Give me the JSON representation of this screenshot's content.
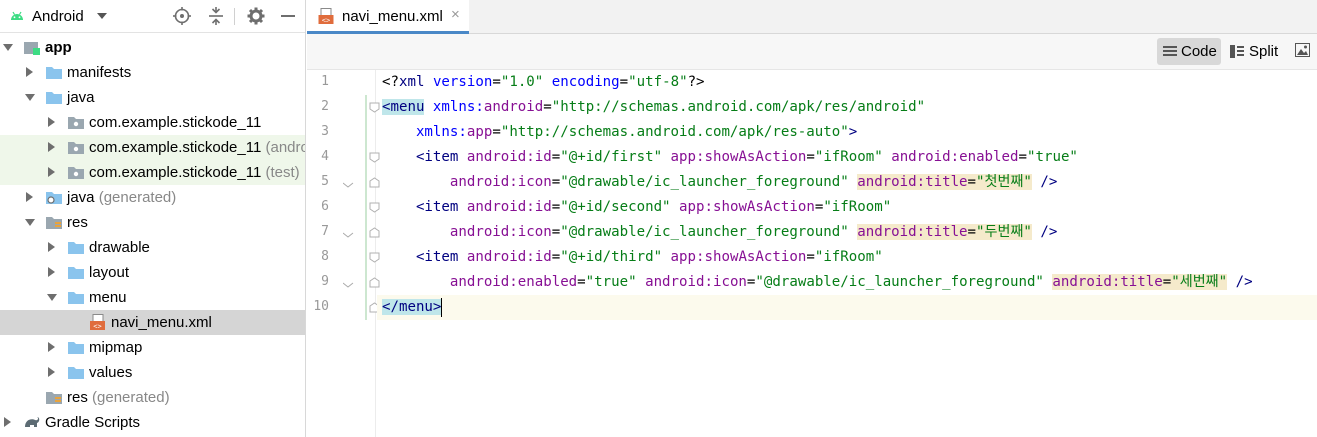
{
  "project_panel": {
    "view_label": "Android",
    "tree": [
      {
        "label": "app",
        "suffix": "",
        "icon": "module-icon",
        "expanded": true,
        "level": 0,
        "bold": true
      },
      {
        "label": "manifests",
        "suffix": "",
        "icon": "folder-icon",
        "expanded": false,
        "level": 1
      },
      {
        "label": "java",
        "suffix": "",
        "icon": "folder-icon",
        "expanded": true,
        "level": 1
      },
      {
        "label": "com.example.stickode_11",
        "suffix": "",
        "icon": "package-icon",
        "expanded": false,
        "level": 2
      },
      {
        "label": "com.example.stickode_11",
        "suffix": "(andro",
        "icon": "package-icon",
        "expanded": false,
        "level": 2
      },
      {
        "label": "com.example.stickode_11",
        "suffix": "(test)",
        "icon": "package-icon",
        "expanded": false,
        "level": 2
      },
      {
        "label": "java",
        "suffix": "(generated)",
        "icon": "generated-folder-icon",
        "expanded": false,
        "level": 1
      },
      {
        "label": "res",
        "suffix": "",
        "icon": "res-folder-icon",
        "expanded": true,
        "level": 1
      },
      {
        "label": "drawable",
        "suffix": "",
        "icon": "folder-icon",
        "expanded": false,
        "level": 2
      },
      {
        "label": "layout",
        "suffix": "",
        "icon": "folder-icon",
        "expanded": false,
        "level": 2
      },
      {
        "label": "menu",
        "suffix": "",
        "icon": "folder-icon",
        "expanded": true,
        "level": 2
      },
      {
        "label": "navi_menu.xml",
        "suffix": "",
        "icon": "xml-file-icon",
        "level": 3,
        "selected": true
      },
      {
        "label": "mipmap",
        "suffix": "",
        "icon": "folder-icon",
        "expanded": false,
        "level": 2
      },
      {
        "label": "values",
        "suffix": "",
        "icon": "folder-icon",
        "expanded": false,
        "level": 2
      },
      {
        "label": "res",
        "suffix": "(generated)",
        "icon": "res-folder-icon",
        "level": 1
      },
      {
        "label": "Gradle Scripts",
        "suffix": "",
        "icon": "gradle-icon",
        "expanded": false,
        "level": 0
      }
    ]
  },
  "editor": {
    "tab": {
      "label": "navi_menu.xml",
      "close": "×"
    },
    "modes": {
      "code": "Code",
      "split": "Split"
    },
    "lines": [
      {
        "num": "1"
      },
      {
        "num": "2"
      },
      {
        "num": "3"
      },
      {
        "num": "4"
      },
      {
        "num": "5"
      },
      {
        "num": "6"
      },
      {
        "num": "7"
      },
      {
        "num": "8"
      },
      {
        "num": "9"
      },
      {
        "num": "10"
      }
    ],
    "code": {
      "l1": {
        "a": "<?",
        "b": "xml",
        "c": " version",
        "d": "=",
        "e": "\"1.0\"",
        "f": " encoding",
        "g": "=",
        "h": "\"utf-8\"",
        "i": "?>"
      },
      "l2": {
        "a": "<menu",
        "b": " xmlns:",
        "c": "android",
        "d": "=",
        "e": "\"http://schemas.android.com/apk/res/android\""
      },
      "l3": {
        "a": "    xmlns:",
        "b": "app",
        "c": "=",
        "d": "\"http://schemas.android.com/apk/res-auto\"",
        "e": ">"
      },
      "l4": {
        "a": "    <item ",
        "b": "android:",
        "c": "id",
        "d": "=",
        "e": "\"@+id/first\"",
        "f": " app:",
        "g": "showAsAction",
        "h": "=",
        "i": "\"ifRoom\"",
        "j": " android:",
        "k": "enabled",
        "l": "=",
        "m": "\"true\""
      },
      "l5": {
        "a": "        android:",
        "b": "icon",
        "c": "=",
        "d": "\"@drawable/ic_launcher_foreground\"",
        "e": " ",
        "f": "android:",
        "g": "title",
        "h": "=",
        "i": "\"첫번째\"",
        "j": " />"
      },
      "l6": {
        "a": "    <item ",
        "b": "android:",
        "c": "id",
        "d": "=",
        "e": "\"@+id/second\"",
        "f": " app:",
        "g": "showAsAction",
        "h": "=",
        "i": "\"ifRoom\""
      },
      "l7": {
        "a": "        android:",
        "b": "icon",
        "c": "=",
        "d": "\"@drawable/ic_launcher_foreground\"",
        "e": " ",
        "f": "android:",
        "g": "title",
        "h": "=",
        "i": "\"두번째\"",
        "j": " />"
      },
      "l8": {
        "a": "    <item ",
        "b": "android:",
        "c": "id",
        "d": "=",
        "e": "\"@+id/third\"",
        "f": " app:",
        "g": "showAsAction",
        "h": "=",
        "i": "\"ifRoom\""
      },
      "l9": {
        "a": "        android:",
        "b": "enabled",
        "c": "=",
        "d": "\"true\"",
        "e": " android:",
        "f": "icon",
        "g": "=",
        "h": "\"@drawable/ic_launcher_foreground\"",
        "i": " ",
        "j": "android:",
        "k": "title",
        "l": "=",
        "m": "\"세번째\"",
        "n": " />"
      },
      "l10": {
        "a": "</menu",
        "b": ">"
      }
    }
  },
  "colors": {
    "accent": "#4a88c7",
    "selection": "#d5d5d5",
    "xml_value": "#067d17",
    "xml_tag": "#000080",
    "xml_attr": "#0000ff",
    "xml_ns": "#871094"
  }
}
